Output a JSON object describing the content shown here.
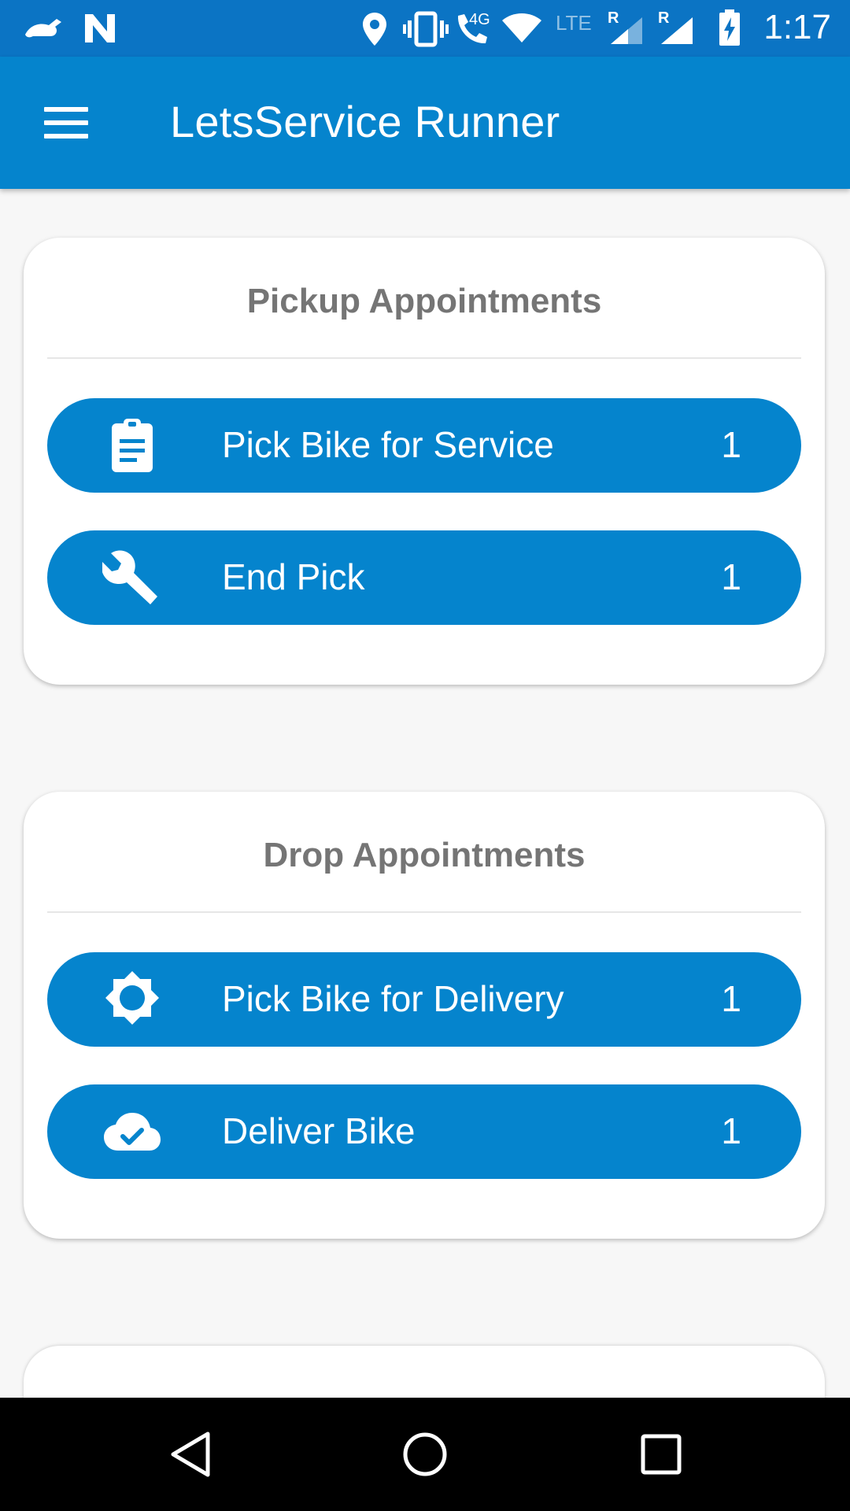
{
  "status_bar": {
    "time": "1:17",
    "network_4g": "4G",
    "network_lte": "LTE",
    "roaming_1": "R",
    "roaming_2": "R",
    "icons": [
      "app-notification-icon",
      "n-notification-icon",
      "location-icon",
      "vibrate-icon",
      "wifi-call-icon",
      "wifi-icon",
      "signal-icon",
      "signal-icon",
      "battery-charging-icon"
    ]
  },
  "app_bar": {
    "title": "LetsService Runner",
    "menu_icon": "hamburger-menu-icon"
  },
  "pickup_card": {
    "title": "Pickup Appointments",
    "items": [
      {
        "label": "Pick Bike for Service",
        "count": "1",
        "icon": "clipboard-icon"
      },
      {
        "label": "End Pick",
        "count": "1",
        "icon": "wrench-icon"
      }
    ]
  },
  "drop_card": {
    "title": "Drop Appointments",
    "items": [
      {
        "label": "Pick Bike for Delivery",
        "count": "1",
        "icon": "brightness-icon"
      },
      {
        "label": "Deliver Bike",
        "count": "1",
        "icon": "cloud-done-icon"
      }
    ]
  },
  "nav_bar": {
    "icons": [
      "back-icon",
      "home-icon",
      "recents-icon"
    ]
  },
  "colors": {
    "primary": "#0584cd",
    "status_bar": "#0b74c4",
    "card_title": "#757575",
    "background": "#f7f7f7"
  }
}
